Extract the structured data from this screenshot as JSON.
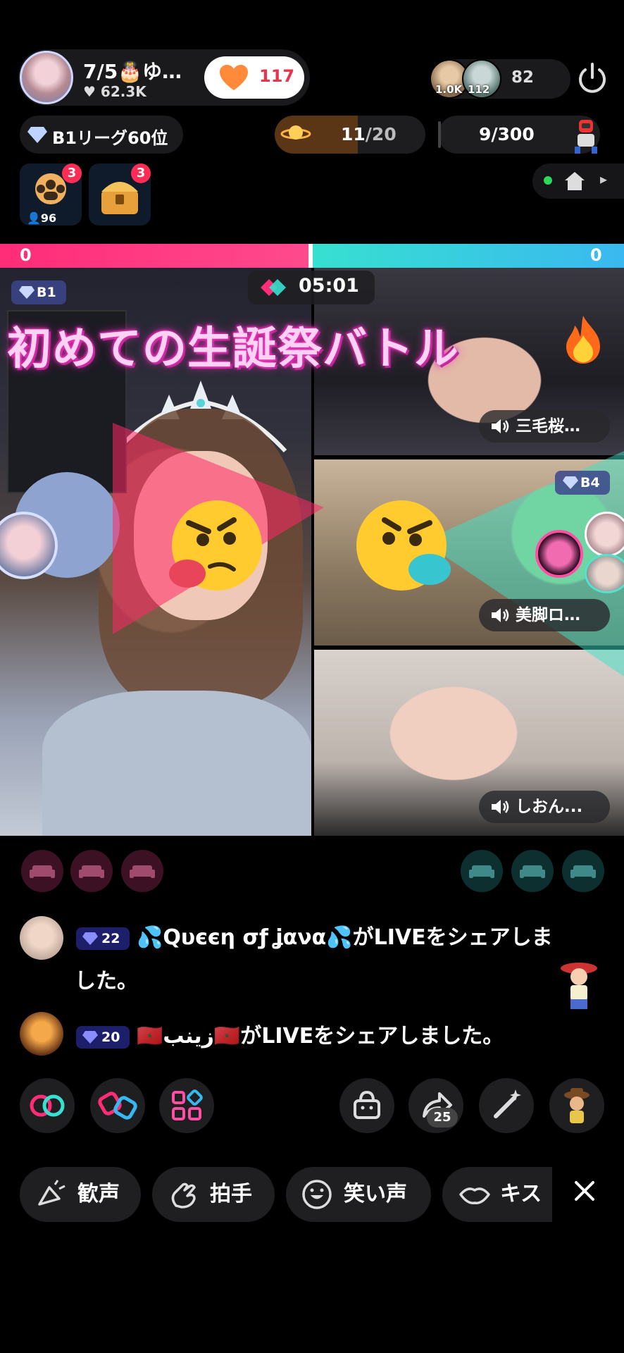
{
  "host": {
    "name": "7/5🎂ゆ…",
    "likes": "62.3K",
    "follow_count": "117"
  },
  "viewers": {
    "avatar1_label": "1.0K",
    "avatar2_label": "112",
    "count": "82"
  },
  "league": {
    "text": "B1リーグ60位"
  },
  "progress": {
    "text_current": "11",
    "text_total": "/20",
    "fill_fraction": 0.55
  },
  "goal": {
    "text": "9/300"
  },
  "badges": [
    {
      "count": "3",
      "sub": "96"
    },
    {
      "count": "3"
    }
  ],
  "battle": {
    "score_left": "0",
    "score_right": "0",
    "timer": "05:01",
    "title": "初めての生誕祭バトル"
  },
  "tiles": {
    "main_badge": "B1",
    "r2_badge": "B4",
    "r1_name": "三毛桜…",
    "r2_name": "美脚ロ…",
    "r3_name": "しおん..."
  },
  "comments": [
    {
      "level": "22",
      "text_line1": "💦Qυєєη σƒ ʝανα💦がLIVEをシェアしま",
      "text_line2": "した。"
    },
    {
      "level": "20",
      "text_line1": "🇲🇦زينب🇲🇦がLIVEをシェアしました。"
    }
  ],
  "controls": {
    "share_count": "25"
  },
  "reactions": [
    {
      "label": "歓声"
    },
    {
      "label": "拍手"
    },
    {
      "label": "笑い声"
    },
    {
      "label": "キス"
    }
  ],
  "colors": {
    "team_left": "#ff2c78",
    "team_right": "#37e0d0",
    "alert": "#e8354b"
  }
}
